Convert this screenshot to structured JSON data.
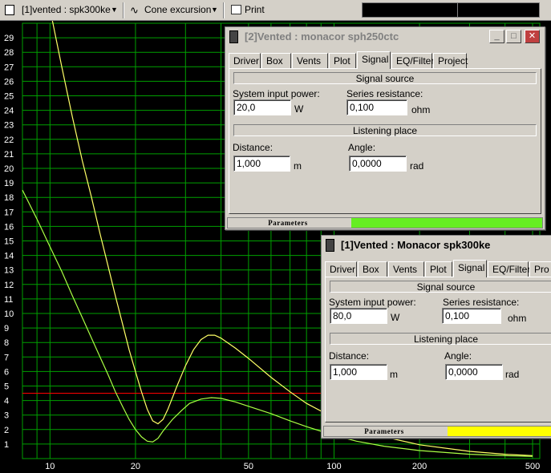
{
  "toolbar": {
    "project_select": "[1]vented : spk300ke",
    "plot_select": "Cone excursion",
    "print_label": "Print"
  },
  "chart_data": {
    "type": "line",
    "x_scale": "log",
    "xlim": [
      8,
      530
    ],
    "ylim": [
      0,
      30
    ],
    "x_ticks": [
      10,
      20,
      50,
      100,
      200,
      500
    ],
    "y_ticks": [
      1,
      2,
      3,
      4,
      5,
      6,
      7,
      8,
      9,
      10,
      11,
      12,
      13,
      14,
      15,
      16,
      17,
      18,
      19,
      20,
      21,
      22,
      23,
      24,
      25,
      26,
      27,
      28,
      29
    ],
    "grid": true,
    "background": "#000000",
    "grid_color": "#00a000",
    "reference_line": {
      "y": 4.5,
      "color": "#ff0000"
    },
    "series": [
      {
        "color": "#ffff66",
        "points": [
          [
            10,
            31
          ],
          [
            11,
            27
          ],
          [
            12,
            23.5
          ],
          [
            13,
            20.5
          ],
          [
            14,
            18
          ],
          [
            15,
            15.5
          ],
          [
            16,
            13.3
          ],
          [
            17,
            11.2
          ],
          [
            18,
            9.3
          ],
          [
            19,
            7.5
          ],
          [
            20,
            6
          ],
          [
            21,
            4.6
          ],
          [
            22,
            3.4
          ],
          [
            23,
            2.6
          ],
          [
            24,
            2.4
          ],
          [
            25,
            2.7
          ],
          [
            26,
            3.4
          ],
          [
            28,
            5
          ],
          [
            30,
            6.4
          ],
          [
            32,
            7.5
          ],
          [
            34,
            8.2
          ],
          [
            36,
            8.5
          ],
          [
            38,
            8.5
          ],
          [
            40,
            8.3
          ],
          [
            45,
            7.6
          ],
          [
            50,
            6.9
          ],
          [
            60,
            5.6
          ],
          [
            70,
            4.6
          ],
          [
            80,
            3.8
          ],
          [
            100,
            2.8
          ],
          [
            120,
            2.1
          ],
          [
            150,
            1.5
          ],
          [
            200,
            0.95
          ],
          [
            300,
            0.5
          ],
          [
            400,
            0.3
          ],
          [
            500,
            0.2
          ]
        ]
      },
      {
        "color": "#aaff44",
        "points": [
          [
            8,
            18.5
          ],
          [
            9,
            16.5
          ],
          [
            10,
            14.6
          ],
          [
            11,
            12.9
          ],
          [
            12,
            11.2
          ],
          [
            13,
            9.7
          ],
          [
            14,
            8.3
          ],
          [
            15,
            7
          ],
          [
            16,
            5.8
          ],
          [
            17,
            4.6
          ],
          [
            18,
            3.6
          ],
          [
            19,
            2.7
          ],
          [
            20,
            2
          ],
          [
            21,
            1.5
          ],
          [
            22,
            1.2
          ],
          [
            23,
            1.15
          ],
          [
            24,
            1.4
          ],
          [
            25,
            1.9
          ],
          [
            27,
            2.7
          ],
          [
            29,
            3.3
          ],
          [
            31,
            3.8
          ],
          [
            34,
            4.1
          ],
          [
            37,
            4.2
          ],
          [
            40,
            4.15
          ],
          [
            45,
            3.9
          ],
          [
            50,
            3.6
          ],
          [
            60,
            3.1
          ],
          [
            70,
            2.6
          ],
          [
            80,
            2.2
          ],
          [
            100,
            1.6
          ],
          [
            120,
            1.2
          ],
          [
            150,
            0.85
          ],
          [
            200,
            0.55
          ],
          [
            300,
            0.3
          ],
          [
            400,
            0.2
          ],
          [
            500,
            0.15
          ]
        ]
      }
    ]
  },
  "window2": {
    "title": "[2]Vented : monacor sph250ctc",
    "tabs": [
      "Driver",
      "Box",
      "Vents",
      "Plot",
      "Signal",
      "EQ/Filter",
      "Project"
    ],
    "active_tab": "Signal",
    "signal_source": "Signal source",
    "power_label": "System input power:",
    "power_value": "20,0",
    "power_unit": "W",
    "resistance_label": "Series resistance:",
    "resistance_value": "0,100",
    "resistance_unit": "ohm",
    "listening_place": "Listening place",
    "distance_label": "Distance:",
    "distance_value": "1,000",
    "distance_unit": "m",
    "angle_label": "Angle:",
    "angle_value": "0,0000",
    "angle_unit": "rad",
    "status_text": "Parameters",
    "status_color": "#66ee22"
  },
  "window1": {
    "title": "[1]Vented : Monacor spk300ke",
    "tabs": [
      "Driver",
      "Box",
      "Vents",
      "Plot",
      "Signal",
      "EQ/Filter",
      "Pro"
    ],
    "active_tab": "Signal",
    "signal_source": "Signal source",
    "power_label": "System input power:",
    "power_value": "80,0",
    "power_unit": "W",
    "resistance_label": "Series resistance:",
    "resistance_value": "0,100",
    "resistance_unit": "ohm",
    "listening_place": "Listening place",
    "distance_label": "Distance:",
    "distance_value": "1,000",
    "distance_unit": "m",
    "angle_label": "Angle:",
    "angle_value": "0,0000",
    "angle_unit": "rad",
    "status_text": "Parameters",
    "status_color": "#ffff00"
  }
}
